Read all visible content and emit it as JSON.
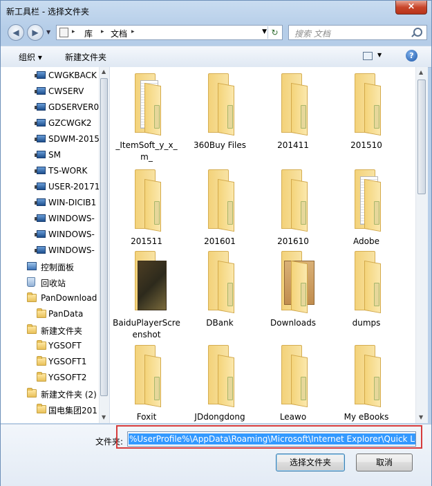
{
  "window": {
    "title": "新工具栏 - 选择文件夹",
    "close_label": "×"
  },
  "address": {
    "crumbs": [
      "库",
      "文档"
    ],
    "search_placeholder": "搜索 文档"
  },
  "toolbar": {
    "organize_label": "组织 ▾",
    "new_folder_label": "新建文件夹"
  },
  "sidebar": {
    "items": [
      {
        "label": "CWGKBACK",
        "icon": "computer-icon",
        "indent": 2
      },
      {
        "label": "CWSERV",
        "icon": "computer-icon",
        "indent": 2
      },
      {
        "label": "GDSERVER0",
        "icon": "computer-icon",
        "indent": 2
      },
      {
        "label": "GZCWGK2",
        "icon": "computer-icon",
        "indent": 2
      },
      {
        "label": "SDWM-2015",
        "icon": "computer-icon",
        "indent": 2
      },
      {
        "label": "SM",
        "icon": "computer-icon",
        "indent": 2
      },
      {
        "label": "TS-WORK",
        "icon": "computer-icon",
        "indent": 2
      },
      {
        "label": "USER-20171",
        "icon": "computer-icon",
        "indent": 2
      },
      {
        "label": "WIN-DICIB1",
        "icon": "computer-icon",
        "indent": 2
      },
      {
        "label": "WINDOWS-",
        "icon": "computer-icon",
        "indent": 2
      },
      {
        "label": "WINDOWS-",
        "icon": "computer-icon",
        "indent": 2
      },
      {
        "label": "WINDOWS-",
        "icon": "computer-icon",
        "indent": 2
      },
      {
        "label": "控制面板",
        "icon": "control-panel-icon",
        "indent": 1
      },
      {
        "label": "回收站",
        "icon": "recycle-bin-icon",
        "indent": 1
      },
      {
        "label": "PanDownload",
        "icon": "folder-icon",
        "indent": 1
      },
      {
        "label": "PanData",
        "icon": "folder-icon",
        "indent": 2
      },
      {
        "label": "新建文件夹",
        "icon": "folder-icon",
        "indent": 1
      },
      {
        "label": "YGSOFT",
        "icon": "folder-icon",
        "indent": 2
      },
      {
        "label": "YGSOFT1",
        "icon": "folder-icon",
        "indent": 2
      },
      {
        "label": "YGSOFT2",
        "icon": "folder-icon",
        "indent": 2
      },
      {
        "label": "新建文件夹 (2)",
        "icon": "folder-icon",
        "indent": 1
      },
      {
        "label": "国电集团201",
        "icon": "folder-icon",
        "indent": 2
      }
    ]
  },
  "folders": [
    {
      "label": "_ItemSoft_y_x_m_",
      "kind": "paper"
    },
    {
      "label": "360Buy Files",
      "kind": "plain"
    },
    {
      "label": "201411",
      "kind": "plain"
    },
    {
      "label": "201510",
      "kind": "plain"
    },
    {
      "label": "201511",
      "kind": "plain"
    },
    {
      "label": "201601",
      "kind": "plain"
    },
    {
      "label": "201610",
      "kind": "plain"
    },
    {
      "label": "Adobe",
      "kind": "paper"
    },
    {
      "label": "BaiduPlayerScreenshot",
      "kind": "cover"
    },
    {
      "label": "DBank",
      "kind": "plain"
    },
    {
      "label": "Downloads",
      "kind": "box"
    },
    {
      "label": "dumps",
      "kind": "plain"
    },
    {
      "label": "Foxit",
      "kind": "plain"
    },
    {
      "label": "JDdongdong",
      "kind": "plain"
    },
    {
      "label": "Leawo",
      "kind": "plain"
    },
    {
      "label": "My eBooks",
      "kind": "plain"
    }
  ],
  "footer": {
    "filename_label": "文件夹:",
    "filename_value": "%UserProfile%\\AppData\\Roaming\\Microsoft\\Internet Explorer\\Quick Launch",
    "select_button": "选择文件夹",
    "cancel_button": "取消"
  }
}
